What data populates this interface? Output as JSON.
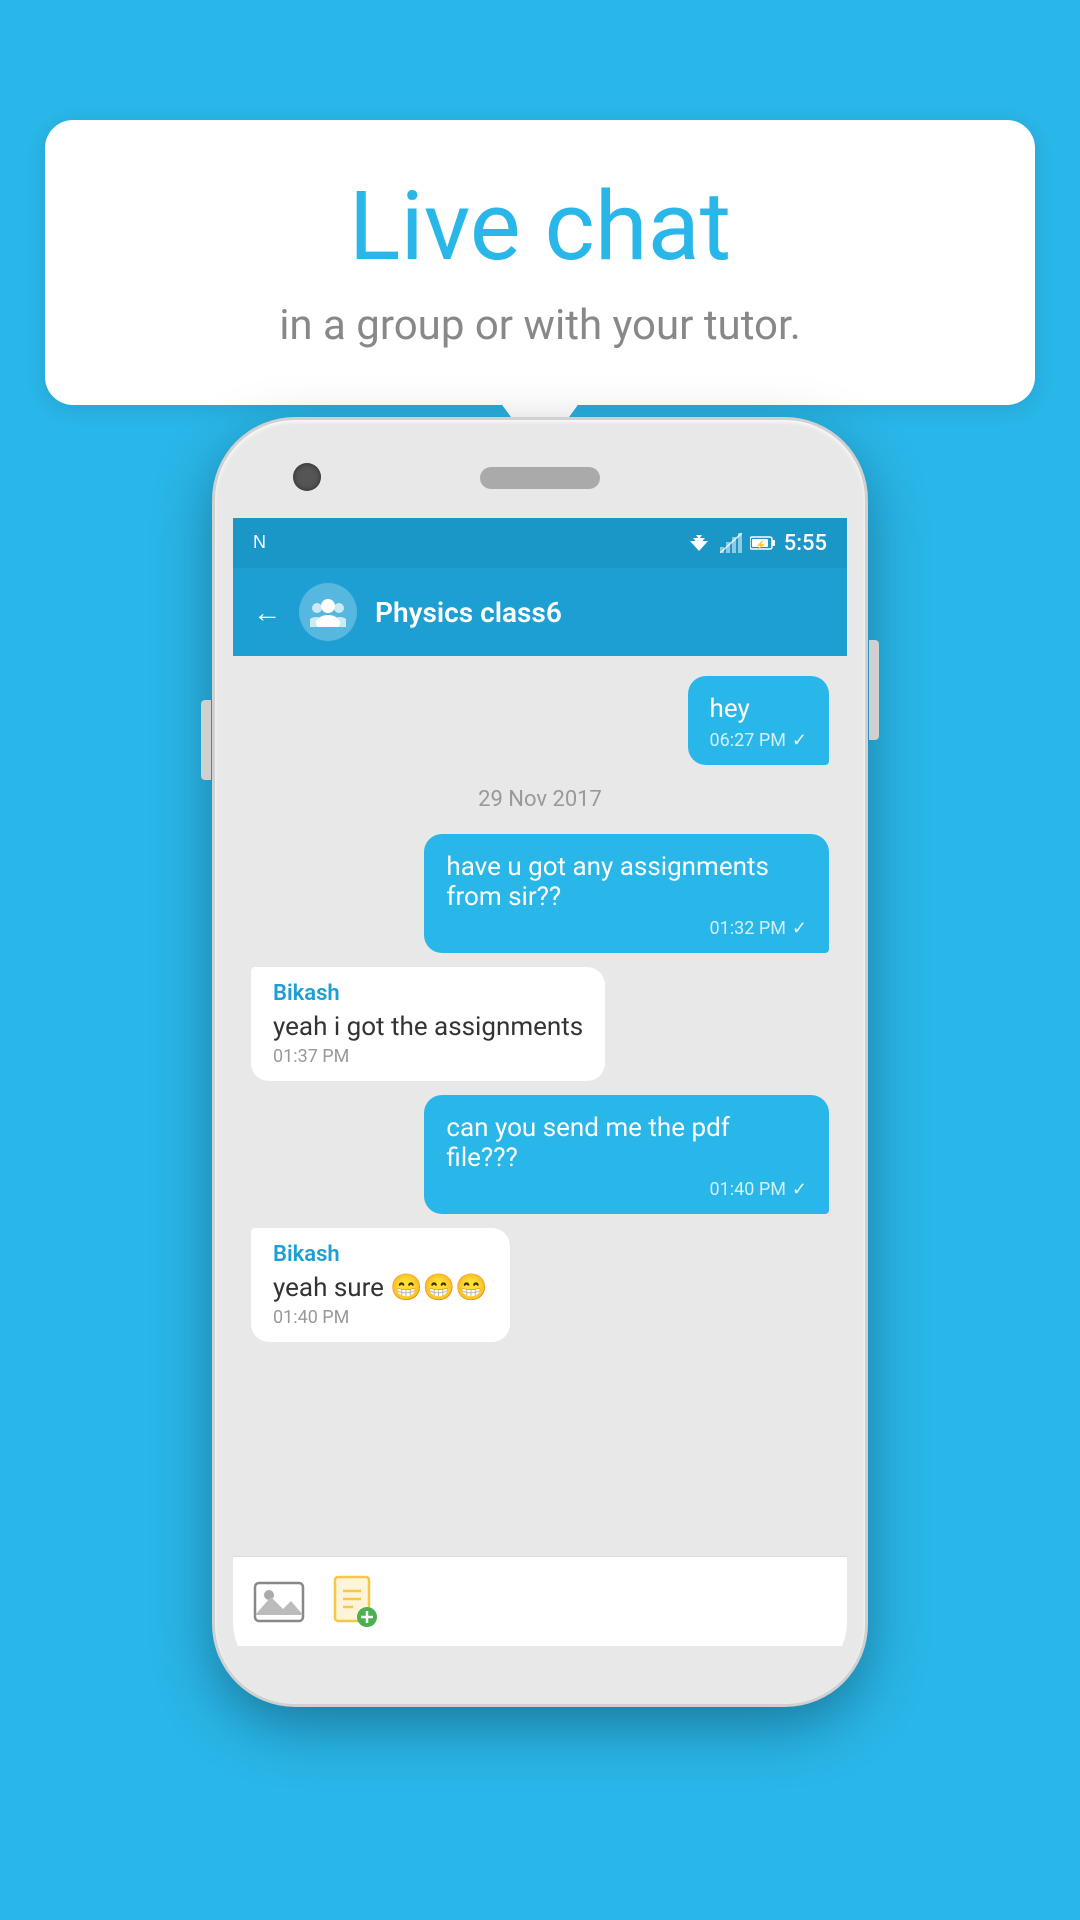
{
  "background_color": "#29b6e8",
  "speech_bubble": {
    "title": "Live chat",
    "subtitle": "in a group or with your tutor."
  },
  "phone": {
    "status_bar": {
      "time": "5:55",
      "network_icon": "N",
      "wifi": "▲",
      "battery": "⚡"
    },
    "header": {
      "back_label": "←",
      "group_name": "Physics class6"
    },
    "messages": [
      {
        "type": "sent",
        "text": "hey",
        "time": "06:27 PM",
        "checked": true
      },
      {
        "type": "date",
        "text": "29  Nov  2017"
      },
      {
        "type": "sent",
        "text": "have u got any assignments from sir??",
        "time": "01:32 PM",
        "checked": true
      },
      {
        "type": "received",
        "sender": "Bikash",
        "text": "yeah i got the assignments",
        "time": "01:37 PM"
      },
      {
        "type": "sent",
        "text": "can you send me the pdf file???",
        "time": "01:40 PM",
        "checked": true
      },
      {
        "type": "received",
        "sender": "Bikash",
        "text": "yeah sure 😁😁😁",
        "time": "01:40 PM"
      }
    ],
    "toolbar": {
      "image_icon": "🖼️",
      "doc_icon": "📄"
    }
  }
}
